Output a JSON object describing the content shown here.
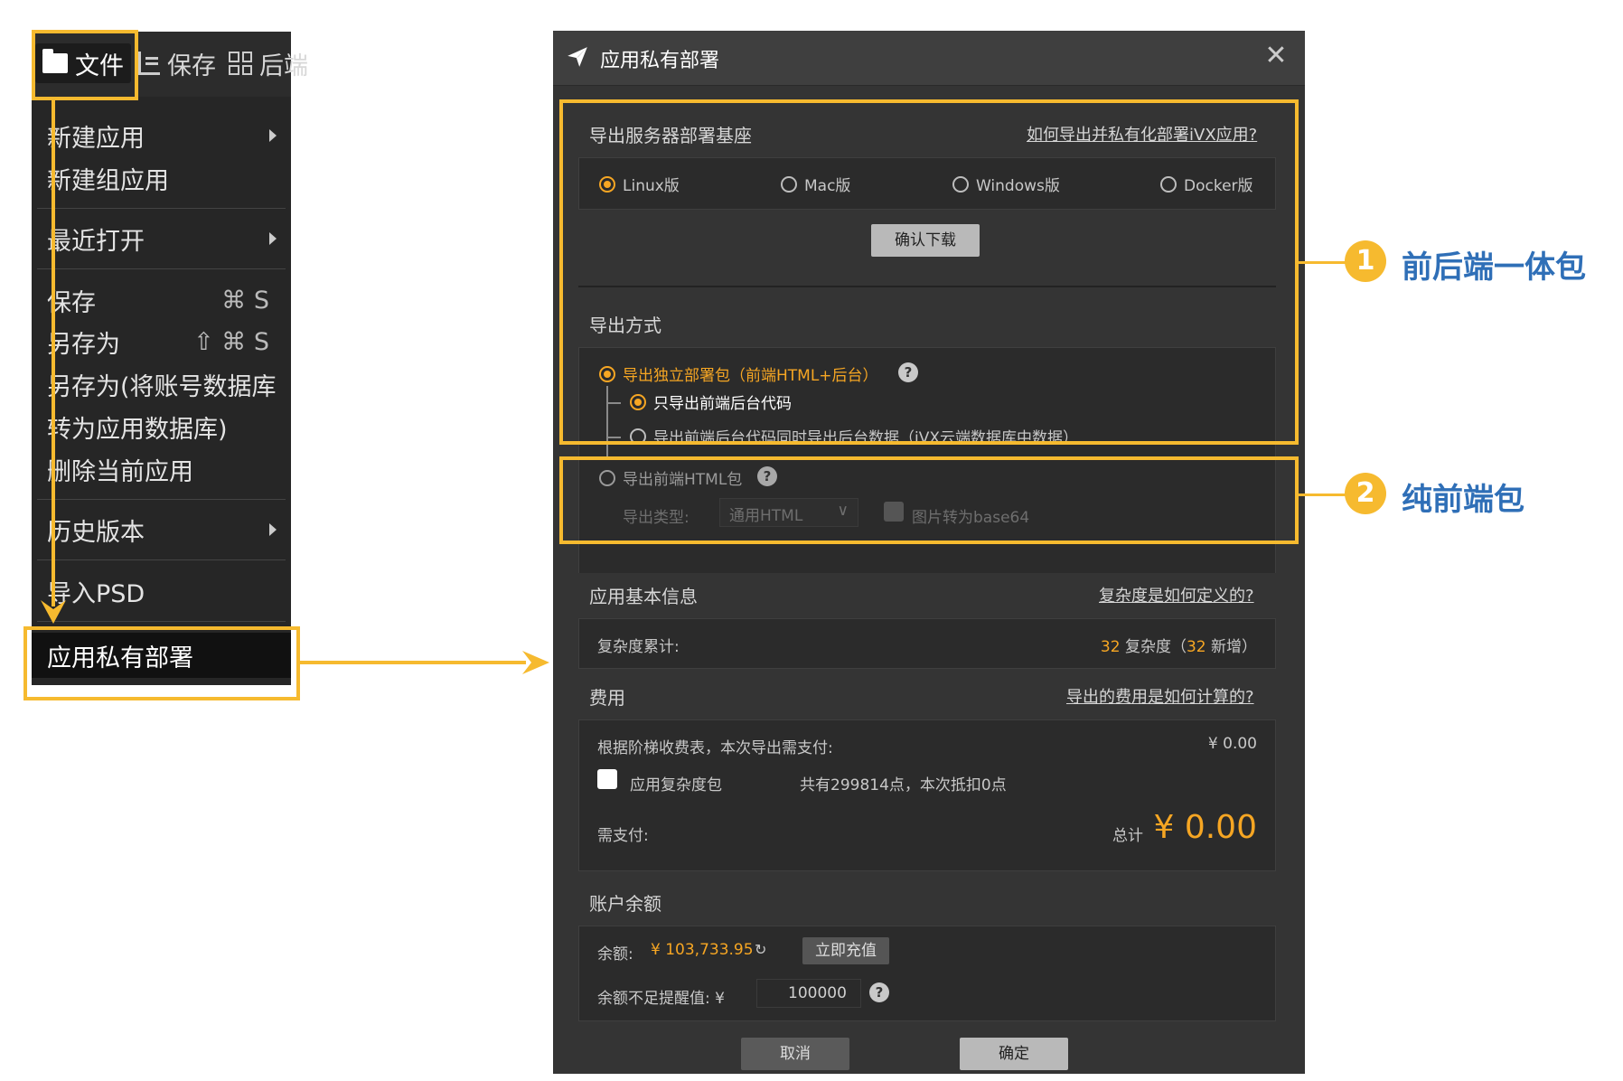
{
  "toolbar": {
    "file_label": "文件",
    "save_label": "保存",
    "backend_label": "后端"
  },
  "menu": {
    "items": [
      {
        "label": "新建应用",
        "submenu": true
      },
      {
        "label": "新建组应用"
      },
      {
        "label": "最近打开",
        "submenu": true
      },
      {
        "label": "保存",
        "shortcut": "⌘ S"
      },
      {
        "label": "另存为",
        "shortcut": "⇧ ⌘ S"
      },
      {
        "label": "另存为(将账号数据库"
      },
      {
        "label": "转为应用数据库)"
      },
      {
        "label": "删除当前应用"
      },
      {
        "label": "历史版本",
        "submenu": true
      },
      {
        "label": "导入PSD"
      },
      {
        "label": "应用私有部署",
        "highlighted": true
      }
    ]
  },
  "dialog": {
    "title": "应用私有部署",
    "server": {
      "title": "导出服务器部署基座",
      "help_link": "如何导出并私有化部署iVX应用?",
      "options": [
        "Linux版",
        "Mac版",
        "Windows版",
        "Docker版"
      ],
      "selected": "Linux版",
      "download_button": "确认下载"
    },
    "export": {
      "title": "导出方式",
      "standalone_label": "导出独立部署包（前端HTML+后台）",
      "sub_option_1": "只导出前端后台代码",
      "sub_option_2": "导出前端后台代码同时导出后台数据（iVX云端数据库中数据）",
      "html_label": "导出前端HTML包",
      "type_label": "导出类型:",
      "type_value": "通用HTML",
      "base64_label": "图片转为base64"
    },
    "info": {
      "title": "应用基本信息",
      "help_link": "复杂度是如何定义的?",
      "complexity_label": "复杂度累计:",
      "complexity_total": "32",
      "complexity_unit": "复杂度（",
      "complexity_new": "32",
      "complexity_new_suffix": "新增）"
    },
    "fee": {
      "title": "费用",
      "help_link": "导出的费用是如何计算的?",
      "tier_label": "根据阶梯收费表，本次导出需支付:",
      "tier_value": "¥ 0.00",
      "package_label": "应用复杂度包",
      "package_note": "共有299814点，本次抵扣0点",
      "pay_label": "需支付:",
      "total_label": "总计",
      "total_value": "¥ 0.00"
    },
    "balance": {
      "title": "账户余额",
      "balance_label": "余额:",
      "balance_value": "¥ 103,733.95",
      "recharge_button": "立即充值",
      "threshold_label": "余额不足提醒值: ¥",
      "threshold_value": "100000"
    },
    "cancel_button": "取消",
    "confirm_button": "确定"
  },
  "annotations": [
    {
      "number": "1",
      "label": "前后端一体包"
    },
    {
      "number": "2",
      "label": "纯前端包"
    }
  ],
  "colors": {
    "accent": "#f6a623",
    "callout": "#f6ba2f",
    "annotation_text": "#2f6fb7",
    "dialog_bg": "#343434"
  }
}
